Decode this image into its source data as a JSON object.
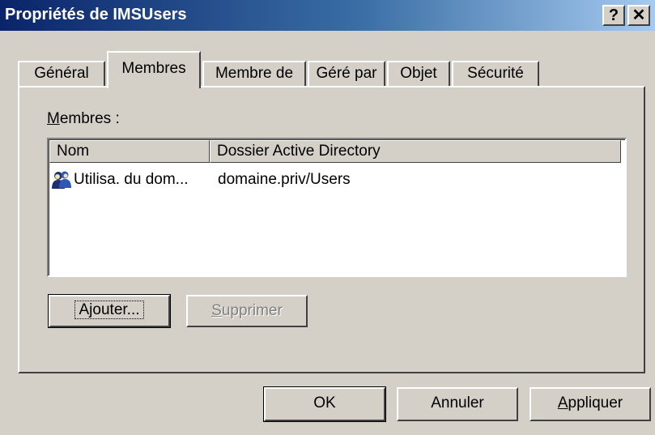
{
  "window": {
    "title": "Propriétés de IMSUsers",
    "help_label": "?",
    "close_label": "✕"
  },
  "tabs": [
    {
      "label": "Général"
    },
    {
      "label": "Membres"
    },
    {
      "label": "Membre de"
    },
    {
      "label": "Géré par"
    },
    {
      "label": "Objet"
    },
    {
      "label": "Sécurité"
    }
  ],
  "members": {
    "label_mnemonic": "M",
    "label_rest": "embres :",
    "columns": [
      "Nom",
      "Dossier Active Directory"
    ],
    "rows": [
      {
        "icon": "user-group-icon",
        "name": "Utilisa. du dom...",
        "folder": "domaine.priv/Users"
      }
    ],
    "add_mnemonic_pre": "A",
    "add_mnemonic": "j",
    "add_rest": "outer...",
    "remove_mnemonic": "S",
    "remove_rest": "upprimer"
  },
  "footer": {
    "ok_label": "OK",
    "cancel_label": "Annuler",
    "apply_mnemonic": "A",
    "apply_rest": "ppliquer"
  }
}
